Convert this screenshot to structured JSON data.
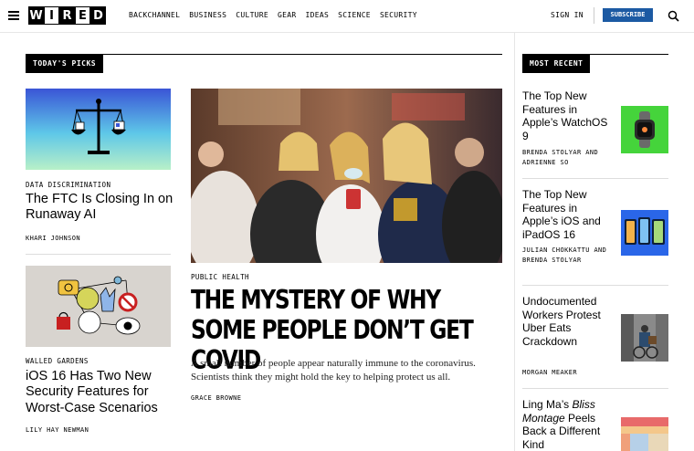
{
  "header": {
    "logo_letters": [
      "W",
      "I",
      "R",
      "E",
      "D"
    ],
    "nav": [
      "BACKCHANNEL",
      "BUSINESS",
      "CULTURE",
      "GEAR",
      "IDEAS",
      "SCIENCE",
      "SECURITY"
    ],
    "sign_in": "SIGN IN",
    "subscribe": "SUBSCRIBE",
    "accent_color": "#1c5aa3"
  },
  "todays_picks": {
    "label": "TODAY'S PICKS",
    "stories": [
      {
        "rubric": "DATA DISCRIMINATION",
        "title": "The FTC Is Closing In on Runaway AI",
        "byline": "KHARI JOHNSON"
      },
      {
        "rubric": "WALLED GARDENS",
        "title": "iOS 16 Has Two New Security Features for Worst-Case Scenarios",
        "byline": "LILY HAY NEWMAN"
      }
    ]
  },
  "feature": {
    "rubric": "PUBLIC HEALTH",
    "title": "THE MYSTERY OF WHY SOME PEOPLE DON’T GET COVID",
    "dek": "A small number of people appear naturally immune to the coronavirus. Scientists think they might hold the key to helping protect us all.",
    "byline": "GRACE BROWNE"
  },
  "most_recent": {
    "label": "MOST RECENT",
    "stories": [
      {
        "title": "The Top New Features in Apple’s WatchOS 9",
        "byline": "BRENDA STOLYAR AND ADRIENNE SO"
      },
      {
        "title": "The Top New Features in Apple’s iOS and iPadOS 16",
        "byline": "JULIAN CHOKKATTU AND BRENDA STOLYAR"
      },
      {
        "title": "Undocumented Workers Protest Uber Eats Crackdown",
        "byline": "MORGAN MEAKER"
      },
      {
        "title_prefix": "Ling Ma’s ",
        "title_italic": "Bliss Montage",
        "title_suffix": " Peels Back a Different Kind",
        "byline": ""
      }
    ]
  }
}
